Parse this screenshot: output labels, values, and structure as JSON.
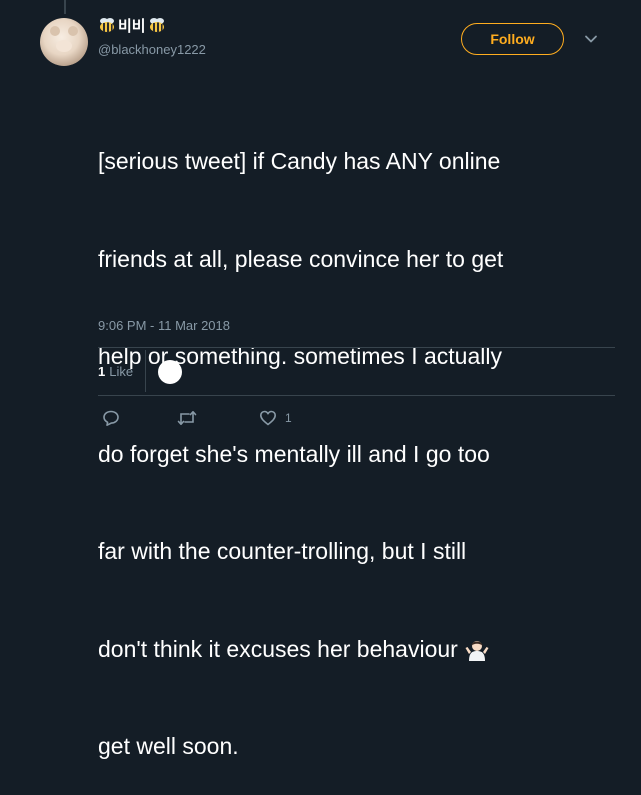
{
  "author": {
    "display_name": "비비",
    "handle": "@blackhoney1222"
  },
  "follow_label": "Follow",
  "tweet": {
    "lines": [
      "[serious tweet] if Candy has ANY online",
      "friends at all, please convince her to get",
      "help or something. sometimes I actually",
      "do forget she's mentally ill and I go too",
      "far with the counter-trolling, but I still",
      "don't think it excuses her behaviour",
      "get well soon."
    ],
    "emoji": "person-shrugging-icon"
  },
  "timestamp": "9:06 PM - 11 Mar 2018",
  "stats": {
    "likes_count": "1",
    "likes_label": "Like"
  },
  "actions": {
    "like_count": "1"
  },
  "colors": {
    "background": "#141d26",
    "accent": "#ffad1f",
    "secondary_text": "#8899a6",
    "divider": "#38444d"
  }
}
